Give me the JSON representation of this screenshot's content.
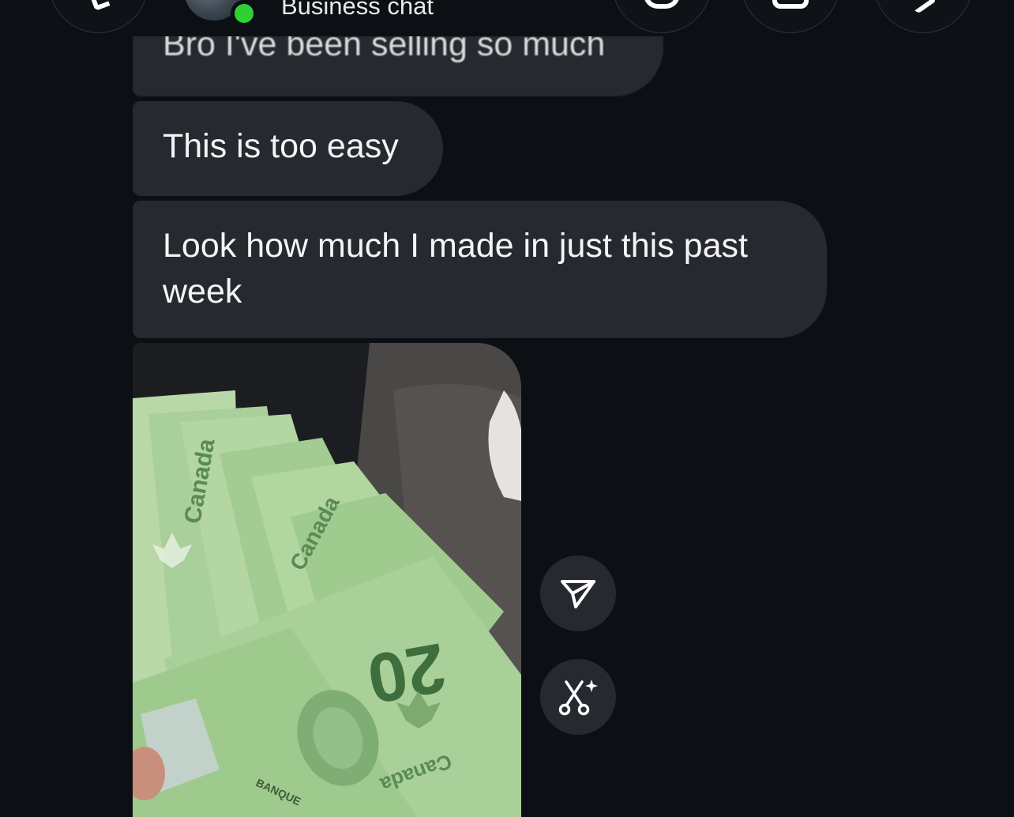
{
  "header": {
    "title": "Business chat",
    "online": true,
    "icons": [
      "back-icon",
      "phone-icon",
      "video-icon",
      "tag-icon"
    ]
  },
  "messages": [
    {
      "text": "Bro I've been selling so much"
    },
    {
      "text": "This is too easy"
    },
    {
      "text": "Look how much I made in just this past week"
    }
  ],
  "attachment": {
    "bill_country": "Canada",
    "bill_denomination": "20",
    "bill_bank_text": "BANQUE"
  },
  "actions": {
    "share_icon": "paper-plane-icon",
    "cutout_icon": "scissors-sparkle-icon"
  },
  "colors": {
    "background": "#0c0f14",
    "bubble": "#26292f",
    "online": "#2ed134",
    "bill_green": "#a9cf9a"
  }
}
